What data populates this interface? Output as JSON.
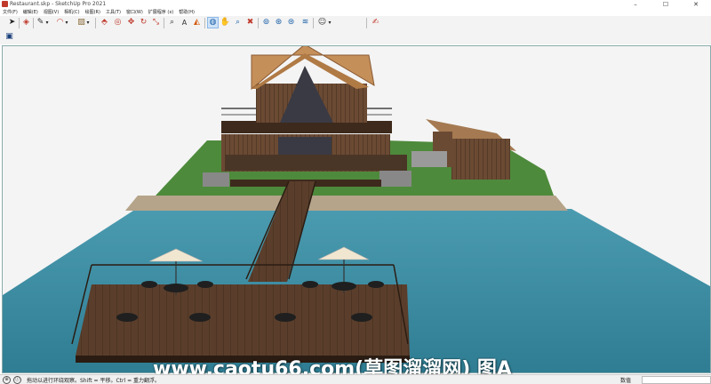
{
  "window": {
    "title": "Restaurant.skp - SketchUp Pro 2021",
    "controls": [
      "–",
      "☐",
      "✕"
    ]
  },
  "menu": [
    "文件(F)",
    "编辑(E)",
    "视图(V)",
    "相机(C)",
    "绘图(R)",
    "工具(T)",
    "窗口(W)",
    "扩展程序 (x)",
    "帮助(H)"
  ],
  "toolbar": {
    "tools": [
      {
        "name": "select-icon",
        "glyph": "➤"
      },
      {
        "name": "eraser-icon",
        "glyph": "◈"
      },
      {
        "name": "line-icon",
        "glyph": "✎"
      },
      {
        "name": "line-menu-icon",
        "glyph": "▾"
      },
      {
        "name": "arc-icon",
        "glyph": "◠"
      },
      {
        "name": "arc-menu-icon",
        "glyph": "▾"
      },
      {
        "name": "rectangle-icon",
        "glyph": "▨"
      },
      {
        "name": "rectangle-menu-icon",
        "glyph": "▾"
      },
      {
        "name": "push-pull-icon",
        "glyph": "⬘"
      },
      {
        "name": "offset-icon",
        "glyph": "◎"
      },
      {
        "name": "move-icon",
        "glyph": "✥"
      },
      {
        "name": "rotate-icon",
        "glyph": "↻"
      },
      {
        "name": "scale-icon",
        "glyph": "⤡"
      },
      {
        "name": "tape-measure-icon",
        "glyph": "⌕"
      },
      {
        "name": "text-icon",
        "glyph": "A"
      },
      {
        "name": "paint-bucket-icon",
        "glyph": "◭"
      },
      {
        "name": "orbit-icon",
        "glyph": "◍"
      },
      {
        "name": "pan-icon",
        "glyph": "✋"
      },
      {
        "name": "zoom-icon",
        "glyph": "⌕"
      },
      {
        "name": "zoom-extents-icon",
        "glyph": "✖"
      },
      {
        "name": "warehouse-icon",
        "glyph": "⊚"
      },
      {
        "name": "extension-warehouse-icon",
        "glyph": "⊛"
      },
      {
        "name": "layout-icon",
        "glyph": "⊜"
      },
      {
        "name": "extension-manager-icon",
        "glyph": "≋"
      },
      {
        "name": "profile-icon",
        "glyph": "☺"
      },
      {
        "name": "profile-menu-icon",
        "glyph": "▾"
      },
      {
        "name": "edit-note-icon",
        "glyph": "✍"
      }
    ],
    "second_row_tool": {
      "name": "style-icon",
      "glyph": "▣"
    }
  },
  "status": {
    "icons": [
      "⊕",
      "ⓘ"
    ],
    "text": "拖动以进行环绕观察。Shift = 平移。Ctrl = 重力翻浮。",
    "measurement_label": "数值"
  },
  "watermark": "www.caotu66.com(草图溜溜网) 图A",
  "colors": {
    "sky": "#f4f4f4",
    "grass": "#4e8a3c",
    "water": "#3d8a9e",
    "wood": "#5a3e2b",
    "roof": "#c58f5a",
    "sand": "#b5a48a"
  }
}
